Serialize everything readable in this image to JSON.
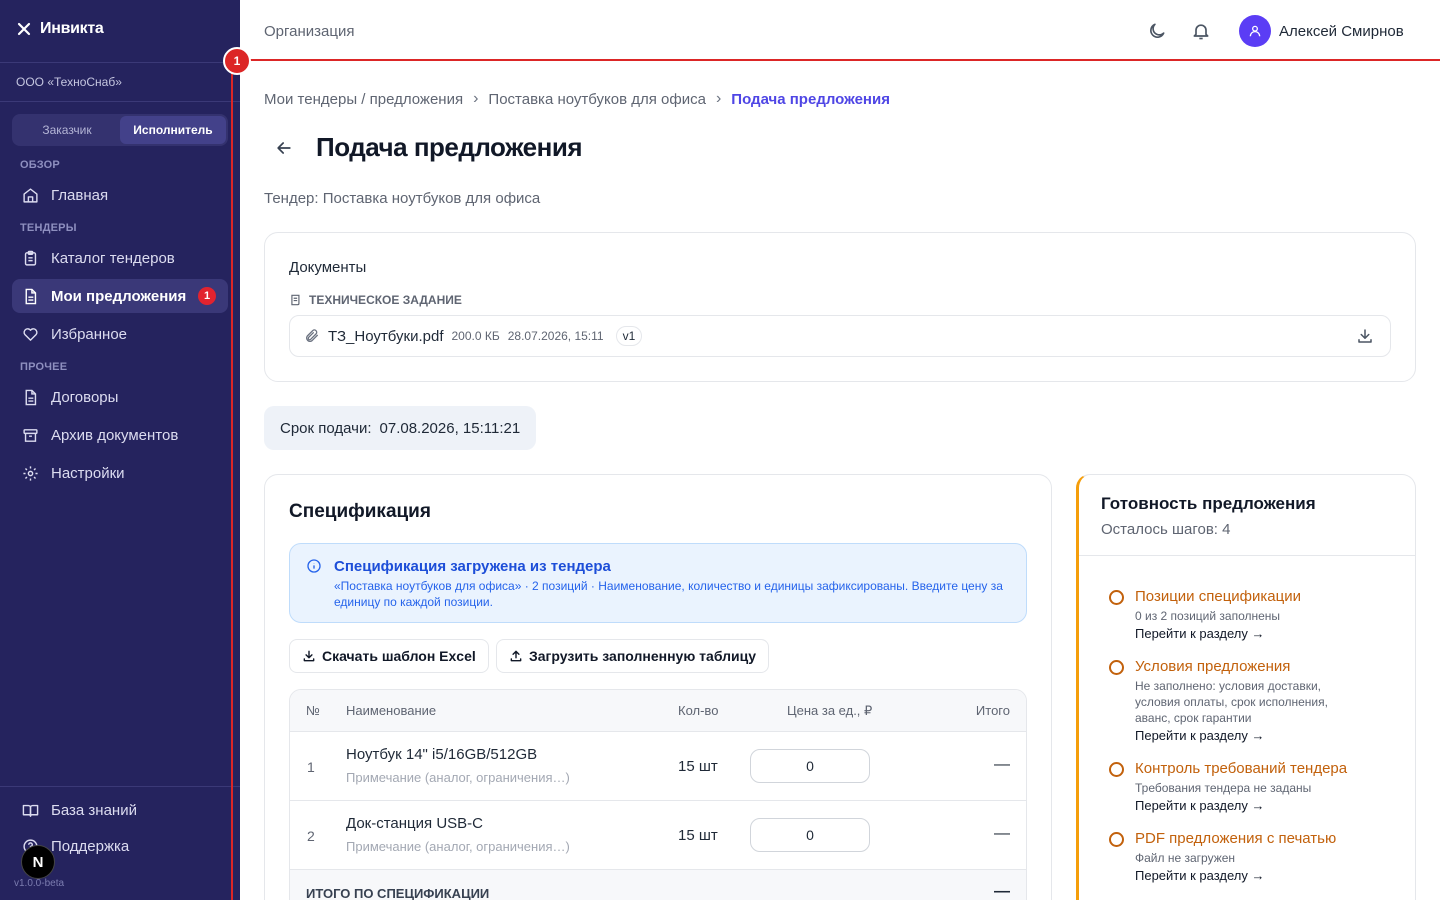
{
  "sidebar": {
    "brand": "Инвикта",
    "org": "ООО «ТехноСнаб»",
    "roles": [
      "Заказчик",
      "Исполнитель"
    ],
    "sections": {
      "overview": "ОБЗОР",
      "tenders": "ТЕНДЕРЫ",
      "other": "ПРОЧЕЕ"
    },
    "items": {
      "home": "Главная",
      "catalog": "Каталог тендеров",
      "my_offers": "Мои предложения",
      "my_offers_badge": "1",
      "favorites": "Избранное",
      "contracts": "Договоры",
      "archive": "Архив документов",
      "settings": "Настройки",
      "knowledge": "База знаний",
      "support": "Поддержка"
    },
    "version": "v1.0.0-beta",
    "n_button": "N"
  },
  "topbar": {
    "crumb": "Организация",
    "username": "Алексей Смирнов"
  },
  "annotation": {
    "marker": "1"
  },
  "breadcrumb": [
    "Мои тендеры / предложения",
    "Поставка ноутбуков для офиса",
    "Подача предложения"
  ],
  "page": {
    "title": "Подача предложения",
    "tender_line": "Тендер: Поставка ноутбуков для офиса"
  },
  "documents": {
    "title": "Документы",
    "section": "ТЕХНИЧЕСКОЕ ЗАДАНИЕ",
    "file": {
      "name": "ТЗ_Ноутбуки.pdf",
      "size": "200.0 КБ",
      "date": "28.07.2026, 15:11",
      "version": "v1"
    }
  },
  "deadline": {
    "label": "Срок подачи:",
    "value": "07.08.2026, 15:11:21"
  },
  "spec": {
    "title": "Спецификация",
    "info_title": "Спецификация загружена из тендера",
    "info_text": "«Поставка ноутбуков для офиса» · 2 позиций · Наименование, количество и единицы зафиксированы. Введите цену за единицу по каждой позиции.",
    "btn_template": "Скачать шаблон Excel",
    "btn_upload": "Загрузить заполненную таблицу",
    "columns": [
      "№",
      "Наименование",
      "Кол-во",
      "Цена за ед., ₽",
      "Итого"
    ],
    "rows": [
      {
        "num": "1",
        "name": "Ноутбук 14\" i5/16GB/512GB",
        "note": "Примечание (аналог, ограничения…)",
        "qty": "15 шт",
        "price": "0",
        "total": "—"
      },
      {
        "num": "2",
        "name": "Док-станция USB-C",
        "note": "Примечание (аналог, ограничения…)",
        "qty": "15 шт",
        "price": "0",
        "total": "—"
      }
    ],
    "footer_label": "ИТОГО ПО СПЕЦИФИКАЦИИ",
    "footer_value": "—"
  },
  "readiness": {
    "title": "Готовность предложения",
    "subtitle": "Осталось шагов: 4",
    "steps": [
      {
        "title": "Позиции спецификации",
        "desc": "0 из 2 позиций заполнены",
        "link": "Перейти к разделу →"
      },
      {
        "title": "Условия предложения",
        "desc": "Не заполнено: условия доставки, условия оплаты, срок исполнения, аванс, срок гарантии",
        "link": "Перейти к разделу →"
      },
      {
        "title": "Контроль требований тендера",
        "desc": "Требования тендера не заданы",
        "link": "Перейти к разделу →"
      },
      {
        "title": "PDF предложения с печатью",
        "desc": "Файл не загружен",
        "link": "Перейти к разделу →"
      }
    ]
  },
  "colors": {
    "sidebar_bg": "#25235e",
    "accent": "#4f46e5",
    "warning": "#c2610c",
    "annotation": "#dc2626"
  }
}
